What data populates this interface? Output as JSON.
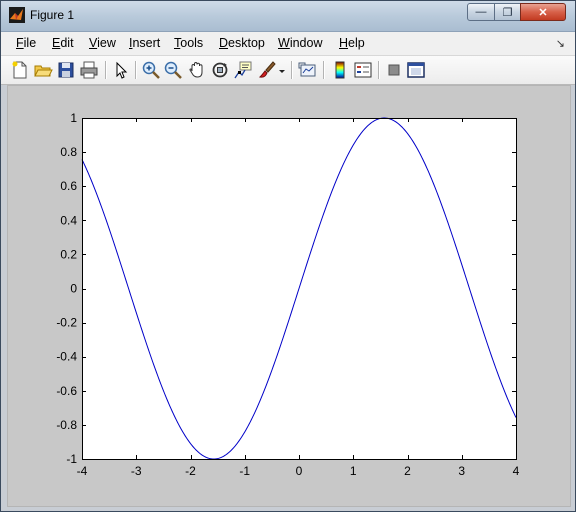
{
  "window": {
    "title": "Figure 1",
    "minimize_glyph": "—",
    "maximize_glyph": "❐",
    "close_glyph": "✕"
  },
  "menu": {
    "items": [
      {
        "label": "File",
        "mnemonic": "F",
        "rest": "ile"
      },
      {
        "label": "Edit",
        "mnemonic": "E",
        "rest": "dit"
      },
      {
        "label": "View",
        "mnemonic": "V",
        "rest": "iew"
      },
      {
        "label": "Insert",
        "mnemonic": "I",
        "rest": "nsert"
      },
      {
        "label": "Tools",
        "mnemonic": "T",
        "rest": "ools"
      },
      {
        "label": "Desktop",
        "mnemonic": "D",
        "rest": "esktop"
      },
      {
        "label": "Window",
        "mnemonic": "W",
        "rest": "indow"
      },
      {
        "label": "Help",
        "mnemonic": "H",
        "rest": "elp"
      }
    ],
    "dock_glyph": "↘"
  },
  "toolbar": {
    "buttons": [
      "new-figure-icon",
      "open-file-icon",
      "save-icon",
      "print-icon",
      "edit-plot-arrow-icon",
      "zoom-in-icon",
      "zoom-out-icon",
      "pan-hand-icon",
      "rotate-3d-icon",
      "data-cursor-icon",
      "brush-icon",
      "link-plot-icon",
      "colorbar-icon",
      "legend-icon",
      "hide-plot-tools-icon",
      "show-plot-tools-icon"
    ]
  },
  "colors": {
    "line": "#0000c8",
    "axes_bg": "#ffffff",
    "figure_bg": "#c8c8c8"
  },
  "chart_data": {
    "type": "line",
    "function": "sin(x)",
    "x_range": [
      -4,
      4
    ],
    "xlim": [
      -4,
      4
    ],
    "ylim": [
      -1,
      1
    ],
    "xticks": [
      -4,
      -3,
      -2,
      -1,
      0,
      1,
      2,
      3,
      4
    ],
    "yticks": [
      -1,
      -0.8,
      -0.6,
      -0.4,
      -0.2,
      0,
      0.2,
      0.4,
      0.6,
      0.8,
      1
    ],
    "xtick_labels": [
      "-4",
      "-3",
      "-2",
      "-1",
      "0",
      "1",
      "2",
      "3",
      "4"
    ],
    "ytick_labels": [
      "-1",
      "-0.8",
      "-0.6",
      "-0.4",
      "-0.2",
      "0",
      "0.2",
      "0.4",
      "0.6",
      "0.8",
      "1"
    ],
    "grid": false,
    "series": [
      {
        "x": [
          -4,
          -3.5,
          -3,
          -2.5,
          -2,
          -1.5708,
          -1.5,
          -1,
          -0.5,
          0,
          0.5,
          1,
          1.5,
          1.5708,
          2,
          2.5,
          3,
          3.5,
          4
        ],
        "y": [
          0.757,
          0.351,
          -0.141,
          -0.598,
          -0.909,
          -1.0,
          -0.997,
          -0.841,
          -0.479,
          0,
          0.479,
          0.841,
          0.997,
          1.0,
          0.909,
          0.598,
          0.141,
          -0.351,
          -0.757
        ]
      }
    ],
    "title": "",
    "xlabel": "",
    "ylabel": ""
  }
}
